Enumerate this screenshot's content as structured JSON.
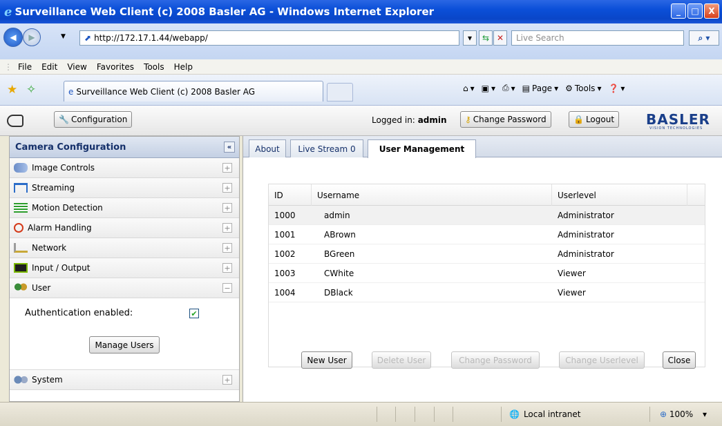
{
  "window": {
    "title": "Surveillance Web Client (c) 2008 Basler AG - Windows Internet Explorer",
    "min_label": "_",
    "max_label": "□",
    "close_label": "X"
  },
  "addressbar": {
    "url": "http://172.17.1.44/webapp/",
    "search_placeholder": "Live Search"
  },
  "menu": [
    "File",
    "Edit",
    "View",
    "Favorites",
    "Tools",
    "Help"
  ],
  "browser_tab": {
    "title": "Surveillance Web Client (c) 2008 Basler AG"
  },
  "command_bar": {
    "page_label": "Page",
    "tools_label": "Tools"
  },
  "app_toolbar": {
    "configuration_label": "Configuration",
    "logged_in_prefix": "Logged in:",
    "logged_in_user": "admin",
    "change_password_label": "Change Password",
    "logout_label": "Logout",
    "brand": "BASLER",
    "brand_sub": "VISION TECHNOLOGIES"
  },
  "sidebar": {
    "header": "Camera Configuration",
    "collapse_label": "«",
    "items": [
      {
        "label": "Image Controls",
        "icon": "people-icon",
        "toggle": "+"
      },
      {
        "label": "Streaming",
        "icon": "streaming-icon",
        "toggle": "+"
      },
      {
        "label": "Motion Detection",
        "icon": "running-man-icon",
        "toggle": "+"
      },
      {
        "label": "Alarm Handling",
        "icon": "alarm-icon",
        "toggle": "+"
      },
      {
        "label": "Network",
        "icon": "network-icon",
        "toggle": "+"
      },
      {
        "label": "Input / Output",
        "icon": "io-icon",
        "toggle": "+"
      },
      {
        "label": "User",
        "icon": "users-icon",
        "toggle": "−"
      }
    ],
    "user_panel": {
      "auth_label": "Authentication enabled:",
      "auth_checked": true,
      "check_mark": "✔",
      "manage_button": "Manage Users"
    },
    "system_item": {
      "label": "System",
      "icon": "gears-icon",
      "toggle": "+"
    }
  },
  "main": {
    "tabs": [
      "About",
      "Live Stream 0",
      "User Management"
    ],
    "active_tab": "User Management",
    "table": {
      "columns": [
        "ID",
        "Username",
        "Userlevel"
      ],
      "rows": [
        {
          "id": "1000",
          "username": "admin",
          "level": "Administrator"
        },
        {
          "id": "1001",
          "username": "ABrown",
          "level": "Administrator"
        },
        {
          "id": "1002",
          "username": "BGreen",
          "level": "Administrator"
        },
        {
          "id": "1003",
          "username": "CWhite",
          "level": "Viewer"
        },
        {
          "id": "1004",
          "username": "DBlack",
          "level": "Viewer"
        }
      ]
    },
    "buttons": {
      "new_user": "New User",
      "delete_user": "Delete User",
      "change_password": "Change Password",
      "change_userlevel": "Change Userlevel",
      "close": "Close"
    }
  },
  "statusbar": {
    "zone": "Local intranet",
    "zoom": "100%"
  }
}
